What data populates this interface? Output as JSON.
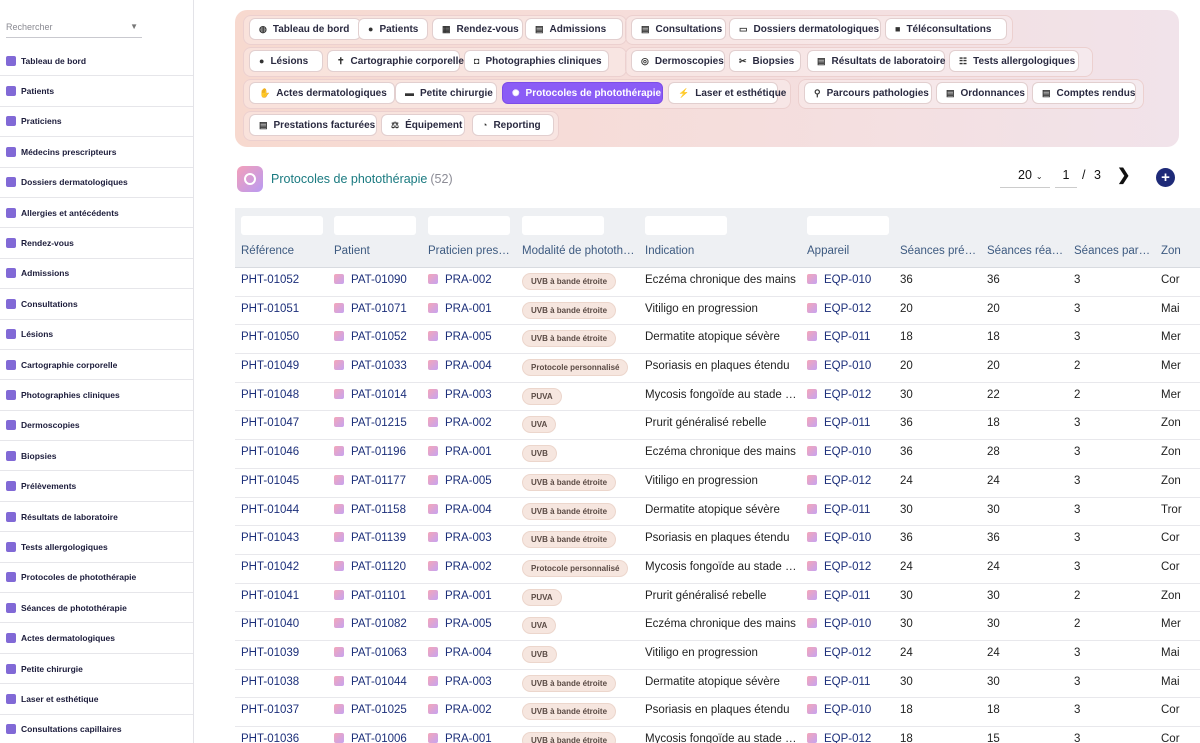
{
  "search": {
    "placeholder": "Rechercher"
  },
  "sidebar": {
    "items": [
      {
        "label": "Tableau de bord",
        "icon": "dashboard-icon",
        "color": "#6b4fcf"
      },
      {
        "label": "Patients",
        "icon": "user-icon",
        "color": "#6b4fcf"
      },
      {
        "label": "Praticiens",
        "icon": "doctor-icon",
        "color": "#6b4fcf"
      },
      {
        "label": "Médecins prescripteurs",
        "icon": "stethoscope-icon",
        "color": "#6b4fcf"
      },
      {
        "label": "Dossiers dermatologiques",
        "icon": "folder-icon",
        "color": "#6b4fcf"
      },
      {
        "label": "Allergies et antécédents",
        "icon": "warning-icon",
        "color": "#6b4fcf"
      },
      {
        "label": "Rendez-vous",
        "icon": "calendar-icon",
        "color": "#6b4fcf"
      },
      {
        "label": "Admissions",
        "icon": "clipboard-icon",
        "color": "#6b4fcf"
      },
      {
        "label": "Consultations",
        "icon": "clipboard-icon",
        "color": "#6b4fcf"
      },
      {
        "label": "Lésions",
        "icon": "target-icon",
        "color": "#6b4fcf"
      },
      {
        "label": "Cartographie corporelle",
        "icon": "body-icon",
        "color": "#6b4fcf"
      },
      {
        "label": "Photographies cliniques",
        "icon": "camera-icon",
        "color": "#6b4fcf"
      },
      {
        "label": "Dermoscopies",
        "icon": "magnifier-icon",
        "color": "#6b4fcf"
      },
      {
        "label": "Biopsies",
        "icon": "scissors-icon",
        "color": "#6b4fcf"
      },
      {
        "label": "Prélèvements",
        "icon": "syringe-icon",
        "color": "#6b4fcf"
      },
      {
        "label": "Résultats de laboratoire",
        "icon": "document-icon",
        "color": "#6b4fcf"
      },
      {
        "label": "Tests allergologiques",
        "icon": "test-tubes-icon",
        "color": "#6b4fcf"
      },
      {
        "label": "Protocoles de photothérapie",
        "icon": "sun-icon",
        "color": "#6b4fcf"
      },
      {
        "label": "Séances de photothérapie",
        "icon": "bulb-icon",
        "color": "#6b4fcf"
      },
      {
        "label": "Actes dermatologiques",
        "icon": "hand-icon",
        "color": "#6b4fcf"
      },
      {
        "label": "Petite chirurgie",
        "icon": "bed-icon",
        "color": "#6b4fcf"
      },
      {
        "label": "Laser et esthétique",
        "icon": "bolt-icon",
        "color": "#6b4fcf"
      },
      {
        "label": "Consultations capillaires",
        "icon": "hair-icon",
        "color": "#6b4fcf"
      }
    ]
  },
  "tabs": {
    "items": [
      {
        "label": "Tableau de bord",
        "icon": "◍"
      },
      {
        "label": "Patients",
        "icon": "●"
      },
      {
        "label": "Rendez-vous",
        "icon": "▦"
      },
      {
        "label": "Admissions",
        "icon": "▤"
      },
      {
        "label": "Consultations",
        "icon": "▤"
      },
      {
        "label": "Dossiers dermatologiques",
        "icon": "▭"
      },
      {
        "label": "Téléconsultations",
        "icon": "■"
      },
      {
        "label": "Lésions",
        "icon": "●"
      },
      {
        "label": "Cartographie corporelle",
        "icon": "✝"
      },
      {
        "label": "Photographies cliniques",
        "icon": "◘"
      },
      {
        "label": "Dermoscopies",
        "icon": "◎"
      },
      {
        "label": "Biopsies",
        "icon": "✂"
      },
      {
        "label": "Résultats de laboratoire",
        "icon": "▤"
      },
      {
        "label": "Tests allergologiques",
        "icon": "☷"
      },
      {
        "label": "Actes dermatologiques",
        "icon": "✋"
      },
      {
        "label": "Petite chirurgie",
        "icon": "▬"
      },
      {
        "label": "Protocoles de photothérapie",
        "icon": "✺",
        "active": true
      },
      {
        "label": "Laser et esthétique",
        "icon": "⚡"
      },
      {
        "label": "Parcours pathologies",
        "icon": "⚲"
      },
      {
        "label": "Ordonnances",
        "icon": "▤"
      },
      {
        "label": "Comptes rendus",
        "icon": "▤"
      },
      {
        "label": "Prestations facturées",
        "icon": "▤"
      },
      {
        "label": "Équipement",
        "icon": "⚖"
      },
      {
        "label": "Reporting",
        "icon": "◔"
      }
    ]
  },
  "page": {
    "title": "Protocoles de photothérapie",
    "count": "(52)",
    "page_size": "20",
    "current_page": "1",
    "slash": "/",
    "total_pages": "3",
    "next": "❯",
    "add": "+"
  },
  "table": {
    "columns": [
      "Référence",
      "Patient",
      "Praticien pres…",
      "Modalité de phototh…",
      "Indication",
      "Appareil",
      "Séances pré…",
      "Séances réa…",
      "Séances par…",
      "Zon"
    ],
    "rows": [
      [
        "PHT-01052",
        "PAT-01090",
        "PRA-002",
        "UVB à bande étroite",
        "Eczéma chronique des mains",
        "EQP-010",
        "36",
        "36",
        "3",
        "Cor"
      ],
      [
        "PHT-01051",
        "PAT-01071",
        "PRA-001",
        "UVB à bande étroite",
        "Vitiligo en progression",
        "EQP-012",
        "20",
        "20",
        "3",
        "Mai"
      ],
      [
        "PHT-01050",
        "PAT-01052",
        "PRA-005",
        "UVB à bande étroite",
        "Dermatite atopique sévère",
        "EQP-011",
        "18",
        "18",
        "3",
        "Mer"
      ],
      [
        "PHT-01049",
        "PAT-01033",
        "PRA-004",
        "Protocole personnalisé",
        "Psoriasis en plaques étendu",
        "EQP-010",
        "20",
        "20",
        "2",
        "Mer"
      ],
      [
        "PHT-01048",
        "PAT-01014",
        "PRA-003",
        "PUVA",
        "Mycosis fongoïde au stade …",
        "EQP-012",
        "30",
        "22",
        "2",
        "Mer"
      ],
      [
        "PHT-01047",
        "PAT-01215",
        "PRA-002",
        "UVA",
        "Prurit généralisé rebelle",
        "EQP-011",
        "36",
        "18",
        "3",
        "Zon"
      ],
      [
        "PHT-01046",
        "PAT-01196",
        "PRA-001",
        "UVB",
        "Eczéma chronique des mains",
        "EQP-010",
        "36",
        "28",
        "3",
        "Zon"
      ],
      [
        "PHT-01045",
        "PAT-01177",
        "PRA-005",
        "UVB à bande étroite",
        "Vitiligo en progression",
        "EQP-012",
        "24",
        "24",
        "3",
        "Zon"
      ],
      [
        "PHT-01044",
        "PAT-01158",
        "PRA-004",
        "UVB à bande étroite",
        "Dermatite atopique sévère",
        "EQP-011",
        "30",
        "30",
        "3",
        "Tror"
      ],
      [
        "PHT-01043",
        "PAT-01139",
        "PRA-003",
        "UVB à bande étroite",
        "Psoriasis en plaques étendu",
        "EQP-010",
        "36",
        "36",
        "3",
        "Cor"
      ],
      [
        "PHT-01042",
        "PAT-01120",
        "PRA-002",
        "Protocole personnalisé",
        "Mycosis fongoïde au stade …",
        "EQP-012",
        "24",
        "24",
        "3",
        "Cor"
      ],
      [
        "PHT-01041",
        "PAT-01101",
        "PRA-001",
        "PUVA",
        "Prurit généralisé rebelle",
        "EQP-011",
        "30",
        "30",
        "2",
        "Zon"
      ],
      [
        "PHT-01040",
        "PAT-01082",
        "PRA-005",
        "UVA",
        "Eczéma chronique des mains",
        "EQP-010",
        "30",
        "30",
        "2",
        "Mer"
      ],
      [
        "PHT-01039",
        "PAT-01063",
        "PRA-004",
        "UVB",
        "Vitiligo en progression",
        "EQP-012",
        "24",
        "24",
        "3",
        "Mai"
      ],
      [
        "PHT-01038",
        "PAT-01044",
        "PRA-003",
        "UVB à bande étroite",
        "Dermatite atopique sévère",
        "EQP-011",
        "30",
        "30",
        "3",
        "Mai"
      ],
      [
        "PHT-01037",
        "PAT-01025",
        "PRA-002",
        "UVB à bande étroite",
        "Psoriasis en plaques étendu",
        "EQP-010",
        "18",
        "18",
        "3",
        "Cor"
      ],
      [
        "PHT-01036",
        "PAT-01006",
        "PRA-001",
        "UVB à bande étroite",
        "Mycosis fongoïde au stade …",
        "EQP-012",
        "18",
        "15",
        "3",
        "Cor"
      ]
    ]
  }
}
